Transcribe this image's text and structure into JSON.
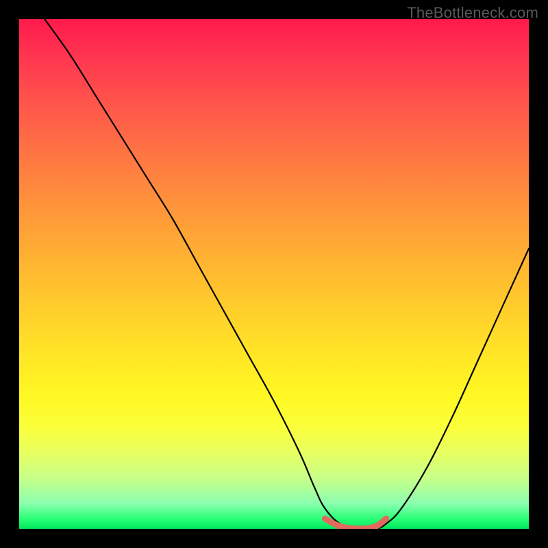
{
  "watermark": "TheBottleneck.com",
  "chart_data": {
    "type": "line",
    "title": "",
    "xlabel": "",
    "ylabel": "",
    "xlim": [
      0,
      100
    ],
    "ylim": [
      0,
      100
    ],
    "grid": false,
    "legend": false,
    "series": [
      {
        "name": "bottleneck-curve",
        "color": "#000000",
        "x": [
          5,
          10,
          15,
          20,
          25,
          30,
          35,
          40,
          45,
          50,
          55,
          58,
          60,
          63,
          67,
          70,
          72,
          75,
          80,
          85,
          90,
          95,
          100
        ],
        "y": [
          100,
          93,
          85,
          77,
          69,
          61,
          52,
          43,
          34,
          25,
          15,
          8,
          4,
          1,
          0,
          0,
          1,
          4,
          12,
          22,
          33,
          44,
          55
        ]
      },
      {
        "name": "optimal-range-marker",
        "color": "#e16a5f",
        "x": [
          60,
          63,
          67,
          70,
          72
        ],
        "y": [
          2,
          0.5,
          0,
          0.5,
          2
        ]
      }
    ],
    "gradient_stops": [
      {
        "pct": 0,
        "color": "#ff1a4d"
      },
      {
        "pct": 18,
        "color": "#ff5a4a"
      },
      {
        "pct": 42,
        "color": "#ffa436"
      },
      {
        "pct": 66,
        "color": "#ffe626"
      },
      {
        "pct": 85,
        "color": "#e8ff60"
      },
      {
        "pct": 100,
        "color": "#00e85c"
      }
    ]
  }
}
